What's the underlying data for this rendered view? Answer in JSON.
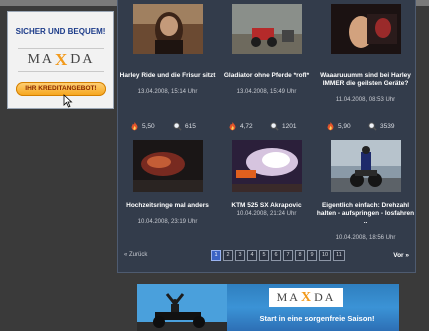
{
  "left_ad": {
    "headline": "SICHER UND BEQUEM!",
    "brand_left": "MA",
    "brand_x": "X",
    "brand_right": "DA",
    "button": "IHR KREDITANGEBOT!"
  },
  "videos": [
    {
      "title": "Harley Ride und die Frisur sitzt",
      "date": "13.04.2008, 15:14 Uhr"
    },
    {
      "title": "Gladiator ohne Pferde *rofl*",
      "date": "13.04.2008, 15:49 Uhr"
    },
    {
      "title": "Waaaruuumm sind bei Harley IMMER die geilsten Geräte?",
      "date": "11.04.2008, 08:53 Uhr"
    },
    {
      "title": "Hochzeitsringe mal anders",
      "date": "10.04.2008, 23:19 Uhr"
    },
    {
      "title": "KTM 525 SX Akrapovic",
      "date": "10.04.2008, 21:24 Uhr"
    },
    {
      "title": "Eigentlich einfach: Drehzahl halten - aufspringen - losfahren ..",
      "date": "10.04.2008, 18:56 Uhr"
    }
  ],
  "stats": [
    {
      "rating": "5,50",
      "views": "615"
    },
    {
      "rating": "4,72",
      "views": "1201"
    },
    {
      "rating": "5,90",
      "views": "3539"
    }
  ],
  "pager": {
    "prev": "« Zurück",
    "next": "Vor »",
    "pages": [
      "1",
      "2",
      "3",
      "4",
      "5",
      "6",
      "7",
      "8",
      "9",
      "10",
      "11"
    ],
    "active": "1"
  },
  "banner": {
    "brand_left": "MA",
    "brand_x": "X",
    "brand_right": "DA",
    "slogan": "Start in eine sorgenfreie Saison!"
  }
}
